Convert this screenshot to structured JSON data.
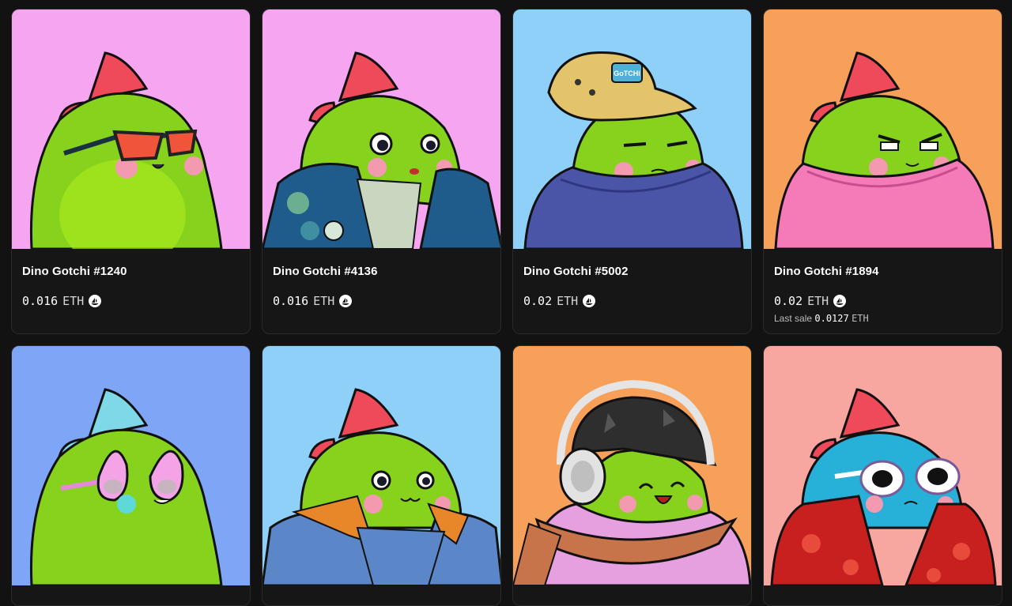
{
  "items": [
    {
      "name": "Dino Gotchi #1240",
      "price": "0.016",
      "currency": "ETH",
      "bg": "#f6a6f0",
      "body": "#86d21c",
      "crest": "#ef4a5a",
      "outfit": "none",
      "outfit_color": "",
      "accessory": "sunglasses"
    },
    {
      "name": "Dino Gotchi #4136",
      "price": "0.016",
      "currency": "ETH",
      "bg": "#f6a6f0",
      "body": "#86d21c",
      "crest": "#ef4a5a",
      "outfit": "jacket",
      "outfit_color": "#1f5c8c",
      "accessory": "none"
    },
    {
      "name": "Dino Gotchi #5002",
      "price": "0.02",
      "currency": "ETH",
      "bg": "#8fd0f8",
      "body": "#86d21c",
      "crest": "#ef4a5a",
      "outfit": "sweater",
      "outfit_color": "#4a55a8",
      "accessory": "bucket-hat",
      "hat_label": "GoTCHi"
    },
    {
      "name": "Dino Gotchi #1894",
      "price": "0.02",
      "currency": "ETH",
      "bg": "#f7a05a",
      "body": "#86d21c",
      "crest": "#ef4a5a",
      "outfit": "sweater",
      "outfit_color": "#f47ab8",
      "accessory": "none",
      "last_sale_label": "Last sale",
      "last_sale_value": "0.0127",
      "last_sale_currency": "ETH"
    },
    {
      "name": "",
      "bg": "#7fa6f6",
      "body": "#86d21c",
      "crest": "#ef4a5a",
      "outfit": "none",
      "outfit_color": "",
      "accessory": "flamingo-glasses"
    },
    {
      "name": "",
      "bg": "#8fd0f8",
      "body": "#86d21c",
      "crest": "#ef4a5a",
      "outfit": "sweater",
      "outfit_color": "#5b86c8",
      "accessory": "none"
    },
    {
      "name": "",
      "bg": "#f7a05a",
      "body": "#86d21c",
      "crest": "#ef4a5a",
      "outfit": "shirt",
      "outfit_color": "#e6a0e0",
      "accessory": "headphones"
    },
    {
      "name": "",
      "bg": "#f7a6a0",
      "body": "#27b0d8",
      "crest": "#ef4a5a",
      "outfit": "hawaiian",
      "outfit_color": "#c8201e",
      "accessory": "white-glasses"
    }
  ],
  "icons": {
    "marketplace": "opensea-icon"
  }
}
